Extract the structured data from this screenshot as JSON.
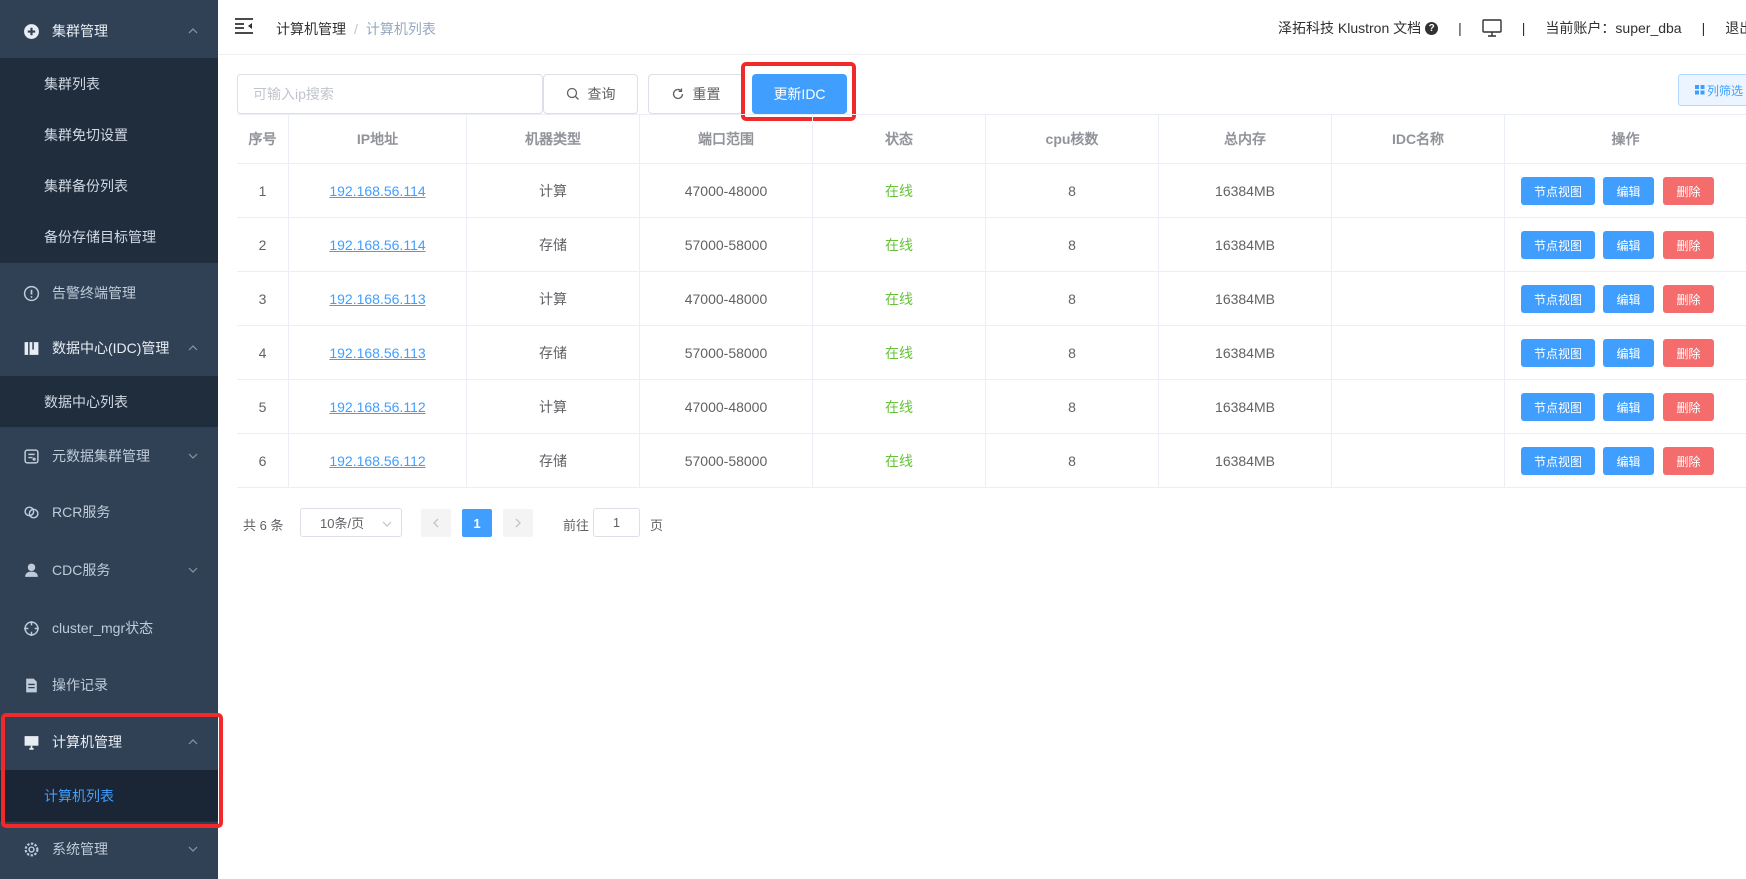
{
  "sidebar": {
    "items": [
      {
        "label": "集群管理",
        "icon": "plus-circle-icon"
      },
      {
        "label": "告警终端管理",
        "icon": "alert-circle-icon"
      },
      {
        "label": "数据中心(IDC)管理",
        "icon": "datacenter-icon"
      },
      {
        "label": "元数据集群管理",
        "icon": "metadata-icon"
      },
      {
        "label": "RCR服务",
        "icon": "link-icon"
      },
      {
        "label": "CDC服务",
        "icon": "user-icon"
      },
      {
        "label": "cluster_mgr状态",
        "icon": "crosshair-icon"
      },
      {
        "label": "操作记录",
        "icon": "document-icon"
      },
      {
        "label": "计算机管理",
        "icon": "monitor-icon"
      },
      {
        "label": "系统管理",
        "icon": "gear-icon"
      }
    ],
    "cluster_sub": [
      "集群列表",
      "集群免切设置",
      "集群备份列表",
      "备份存储目标管理"
    ],
    "idc_sub": [
      "数据中心列表"
    ],
    "computer_sub": [
      "计算机列表"
    ]
  },
  "header": {
    "breadcrumb": [
      "计算机管理",
      "计算机列表"
    ],
    "brand": "泽拓科技 Klustron 文档",
    "account": "当前账户：super_dba",
    "logout": "退出登录"
  },
  "toolbar": {
    "search_placeholder": "可输入ip搜索",
    "query_label": "查询",
    "reset_label": "重置",
    "update_idc_label": "更新IDC",
    "column_filter_label": "列筛选"
  },
  "table": {
    "headers": [
      "序号",
      "IP地址",
      "机器类型",
      "端口范围",
      "状态",
      "cpu核数",
      "总内存",
      "IDC名称",
      "操作"
    ],
    "rows": [
      {
        "no": "1",
        "ip": "192.168.56.114",
        "type": "计算",
        "ports": "47000-48000",
        "status": "在线",
        "cpu": "8",
        "mem": "16384MB",
        "idc": ""
      },
      {
        "no": "2",
        "ip": "192.168.56.114",
        "type": "存储",
        "ports": "57000-58000",
        "status": "在线",
        "cpu": "8",
        "mem": "16384MB",
        "idc": ""
      },
      {
        "no": "3",
        "ip": "192.168.56.113",
        "type": "计算",
        "ports": "47000-48000",
        "status": "在线",
        "cpu": "8",
        "mem": "16384MB",
        "idc": ""
      },
      {
        "no": "4",
        "ip": "192.168.56.113",
        "type": "存储",
        "ports": "57000-58000",
        "status": "在线",
        "cpu": "8",
        "mem": "16384MB",
        "idc": ""
      },
      {
        "no": "5",
        "ip": "192.168.56.112",
        "type": "计算",
        "ports": "47000-48000",
        "status": "在线",
        "cpu": "8",
        "mem": "16384MB",
        "idc": ""
      },
      {
        "no": "6",
        "ip": "192.168.56.112",
        "type": "存储",
        "ports": "57000-58000",
        "status": "在线",
        "cpu": "8",
        "mem": "16384MB",
        "idc": ""
      }
    ],
    "actions": {
      "view": "节点视图",
      "edit": "编辑",
      "delete": "删除"
    }
  },
  "pagination": {
    "total": "共 6 条",
    "page_size": "10条/页",
    "current_page": "1",
    "goto_prefix": "前往",
    "goto_value": "1",
    "goto_suffix": "页"
  },
  "colors": {
    "sidebar_bg": "#304156",
    "submenu_bg": "#1f2d3d",
    "primary": "#409eff",
    "success": "#67c23a",
    "danger": "#f56c6c",
    "highlight": "#f02a2a"
  }
}
